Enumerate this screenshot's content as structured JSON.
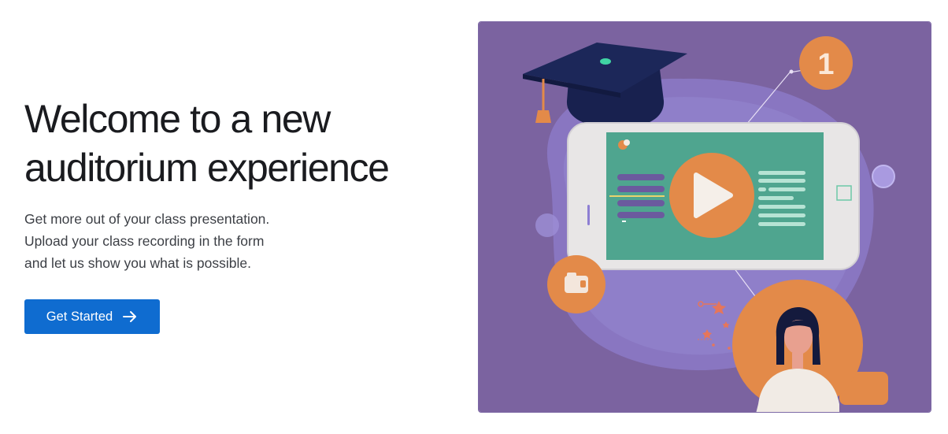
{
  "hero": {
    "title_lines": [
      "Welcome to a new",
      "auditorium experience"
    ],
    "description_lines": [
      "Get more out of your class presentation.",
      "Upload your class recording in the form",
      "and let us show you what is possible."
    ],
    "cta_label": "Get Started",
    "cta_icon": "arrow-right-icon"
  },
  "illustration": {
    "badge_number": "1",
    "icons": [
      "graduation-cap-icon",
      "play-icon",
      "camera-icon",
      "student-avatar"
    ]
  },
  "colors": {
    "accent": "#0f6cd0",
    "illustration_bg": "#7b63a0",
    "orange": "#e38a49",
    "teal": "#4fa58f"
  }
}
